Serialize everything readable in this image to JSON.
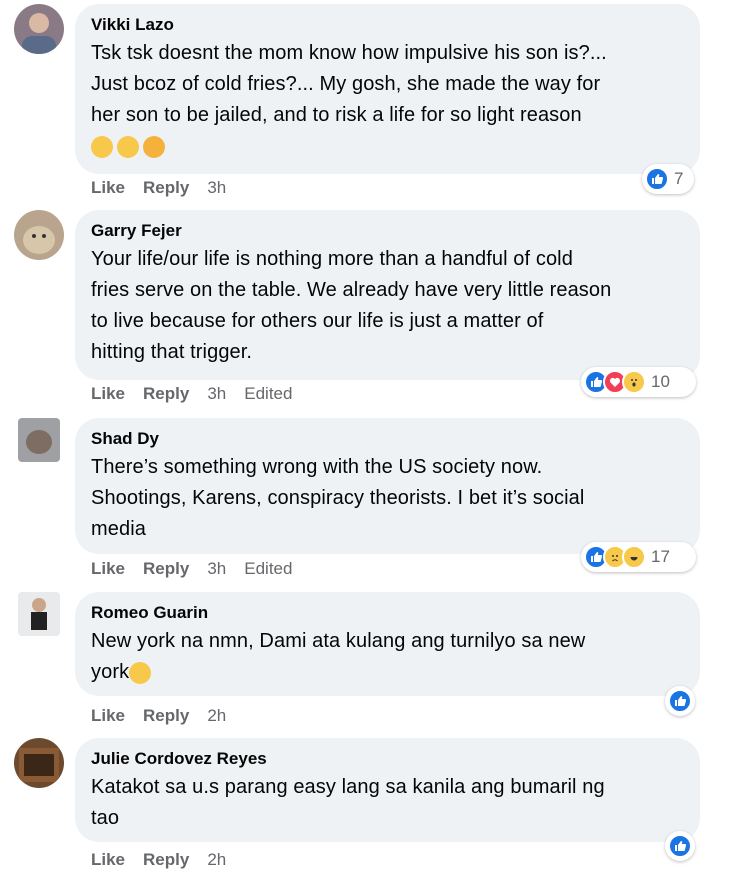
{
  "colors": {
    "bubble": "#eff2f5",
    "like_blue": "#1b74e4",
    "meta_gray": "#65676b"
  },
  "comments": [
    {
      "name": "Vikki Lazo",
      "lines": [
        "Tsk tsk doesnt the mom know how impulsive his son is?...",
        "Just bcoz of cold fries?... My gosh, she made the way for",
        "her son to be jailed, and to risk a life for so light reason"
      ],
      "emojis": [
        "rolling-eyes-emoji",
        "worried-emoji",
        "sad-emoji"
      ],
      "like": "Like",
      "reply": "Reply",
      "time": "3h",
      "edited": "",
      "reaction_count": "7",
      "reactions": [
        "like"
      ]
    },
    {
      "name": "Garry Fejer",
      "lines": [
        "Your life/our life is nothing more than a handful of cold",
        "fries serve on the table. We already have very little reason",
        "to live because for others our life is just a matter of",
        "hitting that trigger."
      ],
      "like": "Like",
      "reply": "Reply",
      "time": "3h",
      "edited": "Edited",
      "reaction_count": "10",
      "reactions": [
        "like",
        "love",
        "wow"
      ]
    },
    {
      "name": "Shad Dy",
      "lines": [
        "There’s something wrong with the US society now.",
        "Shootings, Karens, conspiracy theorists. I bet it’s social",
        "media"
      ],
      "like": "Like",
      "reply": "Reply",
      "time": "3h",
      "edited": "Edited",
      "reaction_count": "17",
      "reactions": [
        "like",
        "sad",
        "haha"
      ]
    },
    {
      "name": "Romeo Guarin",
      "lines": [
        "New york na nmn, Dami ata kulang ang turnilyo sa new",
        "york"
      ],
      "like": "Like",
      "reply": "Reply",
      "time": "2h",
      "edited": "",
      "reaction_count": "",
      "reactions": [
        "like"
      ]
    },
    {
      "name": "Julie Cordovez Reyes",
      "lines": [
        "Katakot sa u.s parang easy lang sa kanila ang bumaril ng",
        "tao"
      ],
      "like": "Like",
      "reply": "Reply",
      "time": "2h",
      "edited": "",
      "reaction_count": "",
      "reactions": [
        "like"
      ]
    }
  ]
}
